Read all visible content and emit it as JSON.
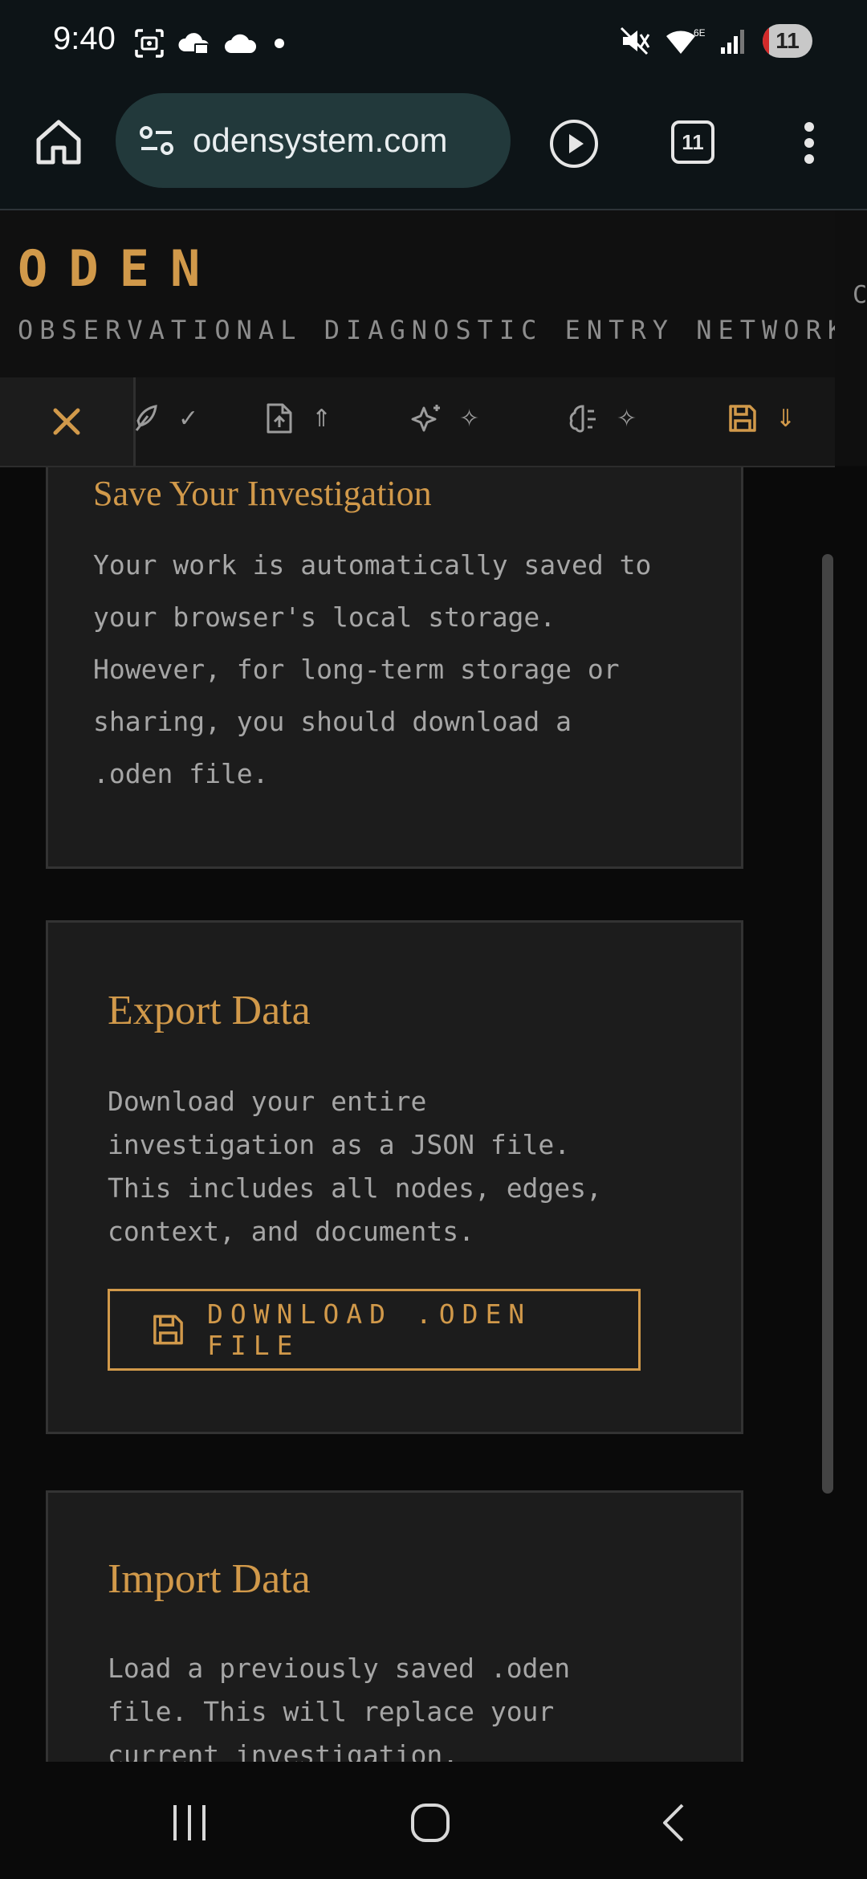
{
  "status_bar": {
    "time": "9:40",
    "network_label": "6E",
    "battery": "11"
  },
  "browser": {
    "url": "odensystem.com",
    "tab_count": "11"
  },
  "header": {
    "logo": "ODEN",
    "subtitle": "OBSERVATIONAL DIAGNOSTIC ENTRY NETWORK",
    "edge_letter": "C"
  },
  "toolbar": {
    "close_glyph": "✕",
    "tools": [
      {
        "icon": "feather-icon",
        "marker": "✓"
      },
      {
        "icon": "file-upload-icon",
        "marker": "⇑"
      },
      {
        "icon": "sparkles-icon",
        "marker": "✧"
      },
      {
        "icon": "brain-icon",
        "marker": "✧"
      },
      {
        "icon": "save-icon",
        "marker": "⇓"
      }
    ]
  },
  "cards": {
    "save": {
      "title": "Save Your Investigation",
      "body": "Your work is automatically saved to\nyour browser's local storage.\nHowever, for long-term storage or\nsharing, you should download a\n.oden file."
    },
    "export": {
      "title": "Export Data",
      "body": "Download your entire\ninvestigation as a JSON file.\nThis includes all nodes, edges,\ncontext, and documents.",
      "button_label": "DOWNLOAD .ODEN FILE"
    },
    "import": {
      "title": "Import Data",
      "body": "Load a previously saved .oden\nfile. This will replace your\ncurrent investigation."
    }
  },
  "colors": {
    "accent": "#d1994a",
    "card_bg": "#1c1c1c",
    "body_text": "#a6a6a6"
  }
}
